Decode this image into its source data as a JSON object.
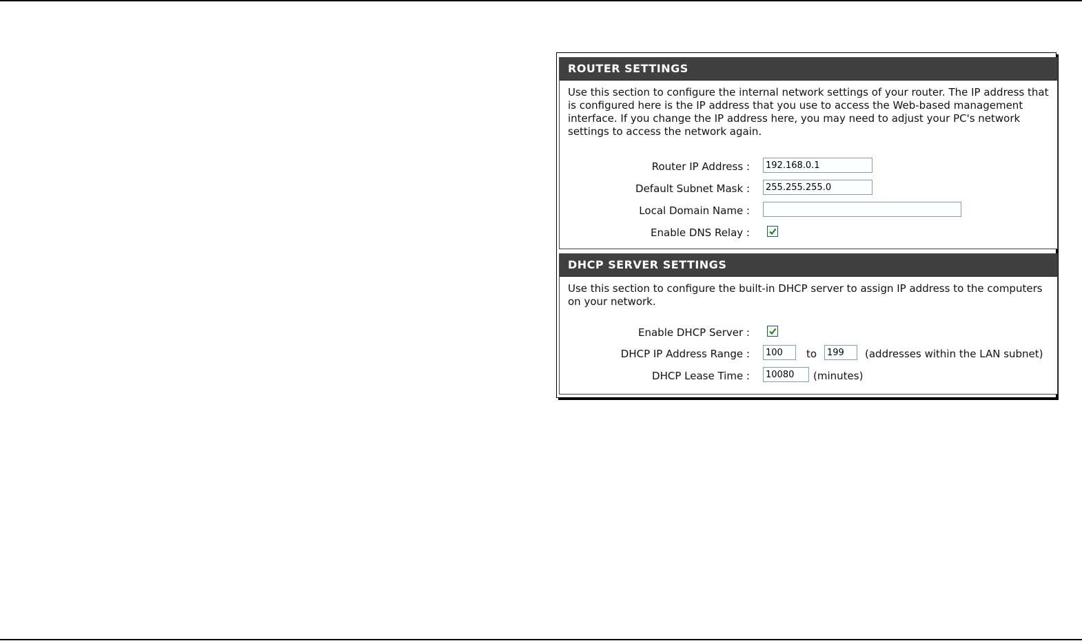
{
  "router": {
    "title": "ROUTER SETTINGS",
    "description": "Use this section to configure the internal network settings of your router. The IP address that is configured here is the IP address that you use to access the Web-based management interface. If you change the IP address here, you may need to adjust your PC's network settings to access the network again.",
    "fields": {
      "ip_label": "Router IP Address :",
      "ip_value": "192.168.0.1",
      "subnet_label": "Default Subnet Mask :",
      "subnet_value": "255.255.255.0",
      "domain_label": "Local Domain Name :",
      "domain_value": "",
      "dns_relay_label": "Enable DNS Relay :",
      "dns_relay_checked": true
    }
  },
  "dhcp": {
    "title": "DHCP SERVER SETTINGS",
    "description": "Use this section to configure the built-in DHCP server to assign IP address to the computers on your network.",
    "fields": {
      "enable_label": "Enable DHCP Server :",
      "enable_checked": true,
      "range_label": "DHCP IP Address Range :",
      "range_start": "100",
      "range_to": "to",
      "range_end": "199",
      "range_note": "(addresses within the LAN subnet)",
      "lease_label": "DHCP Lease Time :",
      "lease_value": "10080",
      "lease_unit": "(minutes)"
    }
  },
  "colors": {
    "header_bg": "#404040",
    "checkmark": "#1a7a1a"
  }
}
